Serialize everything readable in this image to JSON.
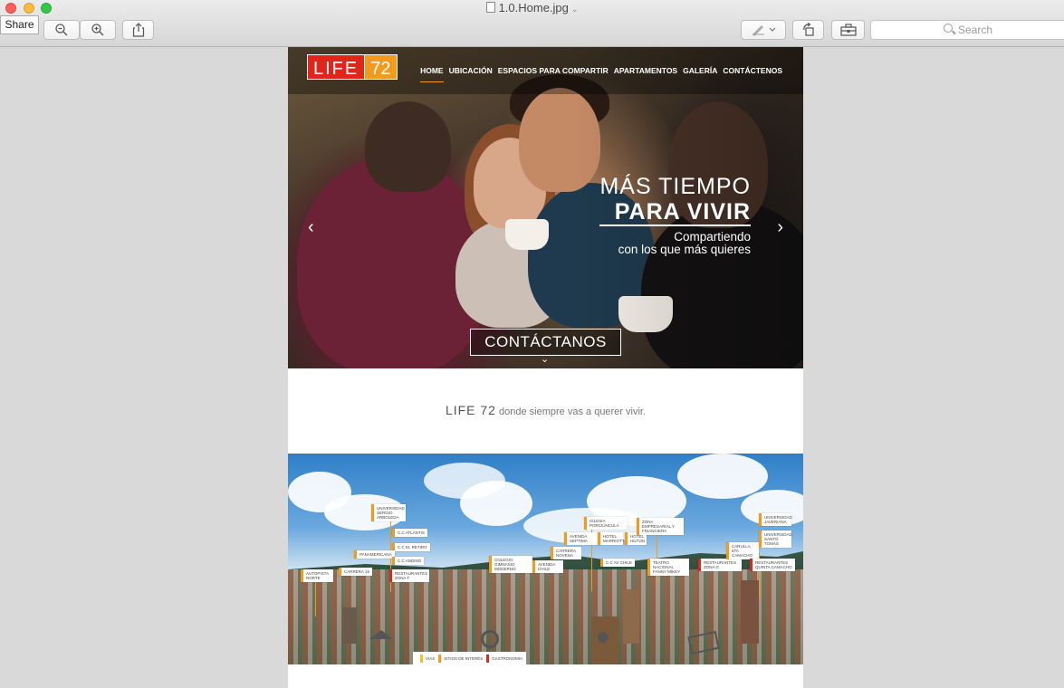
{
  "window": {
    "title": "1.0.Home.jpg",
    "tooltip": "Share",
    "search_placeholder": "Search"
  },
  "site": {
    "logo": {
      "part1": "LIFE",
      "part2": "72"
    },
    "nav": [
      {
        "label": "HOME"
      },
      {
        "label": "UBICACIÓN"
      },
      {
        "label": "ESPACIOS PARA COMPARTIR"
      },
      {
        "label": "APARTAMENTOS"
      },
      {
        "label": "GALERÍA"
      },
      {
        "label": "CONTÁCTENOS"
      }
    ],
    "hero": {
      "line1": "MÁS TIEMPO",
      "line2": "PARA VIVIR",
      "sub1": "Compartiendo",
      "sub2": "con los que más quieres",
      "cta": "CONTÁCTANOS",
      "prev_glyph": "‹",
      "next_glyph": "›",
      "chevron_glyph": "⌄"
    },
    "tagline": {
      "brand": "LIFE 72",
      "text": " donde siempre vas a querer vivir."
    },
    "panorama": {
      "pois": [
        {
          "label": "UNIVERSIDAD SERGIO ARBOLEDA"
        },
        {
          "label": "C.C ATLANTIS"
        },
        {
          "label": "C.C EL RETIRO"
        },
        {
          "label": "PANAMERICANA"
        },
        {
          "label": "C.C ANDINO"
        },
        {
          "label": "AUTOPISTA NORTE"
        },
        {
          "label": "CARRERA 15"
        },
        {
          "label": "RESTAURANTES ZONA T"
        },
        {
          "label": "COLEGIO GIMNASIO MODERNO"
        },
        {
          "label": "AVENIDA CHILE"
        },
        {
          "label": "CARRERA NOVENA"
        },
        {
          "label": "AVENIDA SEPTIMA"
        },
        {
          "label": "IGLESIA PORCIÚNCULA"
        },
        {
          "label": "HOTEL MARRIOTT"
        },
        {
          "label": "HOTEL HILTON"
        },
        {
          "label": "ZONA EMPRESARIAL Y FINANCIERA"
        },
        {
          "label": "C.C AV CHILE"
        },
        {
          "label": "TEATRO NACIONAL FANNY MIKEY"
        },
        {
          "label": "RESTAURANTES ZONA G"
        },
        {
          "label": "CARULLA 6TA CAMACHO"
        },
        {
          "label": "RESTAURANTES QUINTA CAMACHO"
        },
        {
          "label": "UNIVERSIDAD JAVERIANA"
        },
        {
          "label": "UNIVERSIDAD SANTO TOMÁS"
        }
      ],
      "legend": [
        {
          "label": "VÍAS",
          "color": "#f2c21e"
        },
        {
          "label": "SITIOS DE INTERÉS",
          "color": "#f29a1e"
        },
        {
          "label": "GASTRONOMÍA",
          "color": "#e0261c"
        }
      ]
    }
  }
}
